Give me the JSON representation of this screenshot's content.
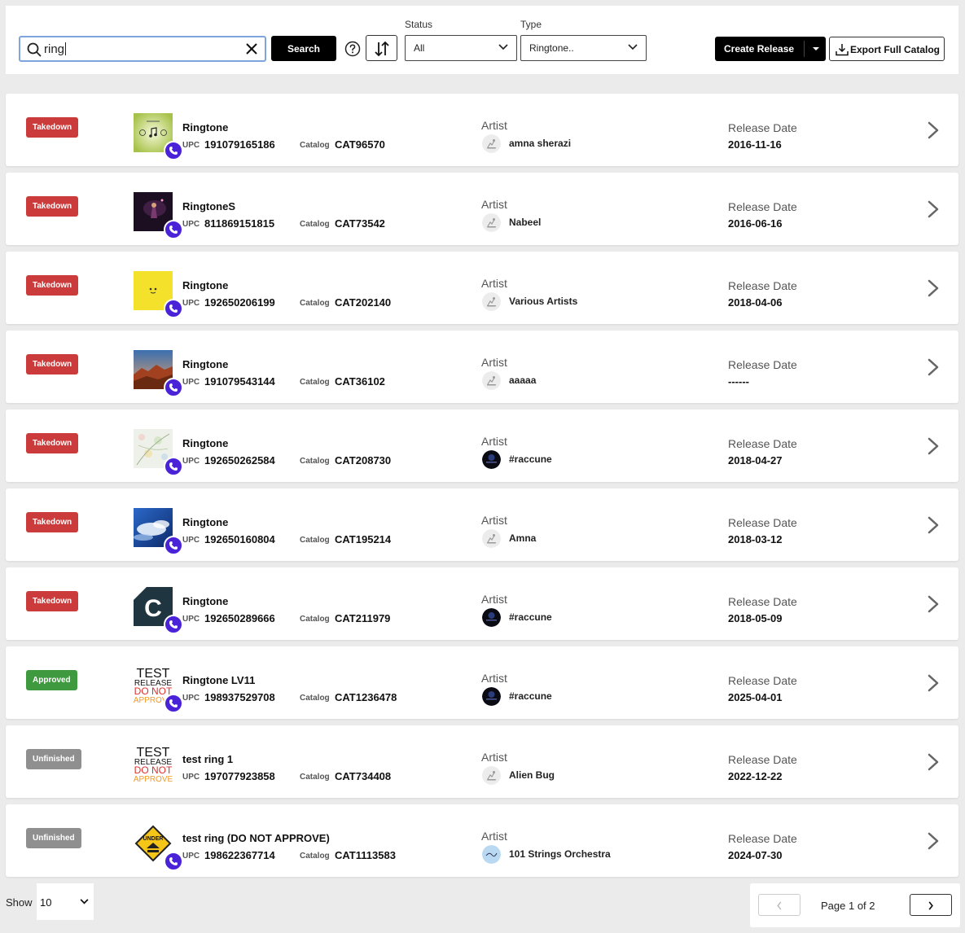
{
  "search": {
    "value": "ring",
    "button_label": "Search"
  },
  "filters": {
    "status_label": "Status",
    "status_value": "All",
    "type_label": "Type",
    "type_value": "Ringtone.."
  },
  "actions": {
    "create_label": "Create Release",
    "export_label": "Export Full Catalog"
  },
  "list_labels": {
    "upc": "UPC",
    "catalog": "Catalog",
    "artist": "Artist",
    "release_date": "Release Date"
  },
  "status_colors": {
    "Takedown": "#cc3b3b",
    "Approved": "#3f9a3f",
    "Unfinished": "#8f8f8f"
  },
  "releases": [
    {
      "status": "Takedown",
      "title": "Ringtone",
      "upc": "191079165186",
      "catalog": "CAT96570",
      "artist": "amna sherazi",
      "release_date": "2016-11-16",
      "art": "lime-music-art",
      "avatar": "placeholder"
    },
    {
      "status": "Takedown",
      "title": "RingtoneS",
      "upc": "811869151815",
      "catalog": "CAT73542",
      "artist": "Nabeel",
      "release_date": "2016-06-16",
      "art": "dark-concert-art",
      "avatar": "placeholder"
    },
    {
      "status": "Takedown",
      "title": "Ringtone",
      "upc": "192650206199",
      "catalog": "CAT202140",
      "artist": "Various Artists",
      "release_date": "2018-04-06",
      "art": "yellow-art",
      "avatar": "placeholder"
    },
    {
      "status": "Takedown",
      "title": "Ringtone",
      "upc": "191079543144",
      "catalog": "CAT36102",
      "artist": "aaaaa",
      "release_date": "------",
      "art": "canyon-art",
      "avatar": "placeholder"
    },
    {
      "status": "Takedown",
      "title": "Ringtone",
      "upc": "192650262584",
      "catalog": "CAT208730",
      "artist": "#raccune",
      "release_date": "2018-04-27",
      "art": "floral-art",
      "avatar": "dark"
    },
    {
      "status": "Takedown",
      "title": "Ringtone",
      "upc": "192650160804",
      "catalog": "CAT195214",
      "artist": "Amna",
      "release_date": "2018-03-12",
      "art": "sky-art",
      "avatar": "placeholder"
    },
    {
      "status": "Takedown",
      "title": "Ringtone",
      "upc": "192650289666",
      "catalog": "CAT211979",
      "artist": "#raccune",
      "release_date": "2018-05-09",
      "art": "c-logo-art",
      "avatar": "dark"
    },
    {
      "status": "Approved",
      "title": "Ringtone LV11",
      "upc": "198937529708",
      "catalog": "CAT1236478",
      "artist": "#raccune",
      "release_date": "2025-04-01",
      "art": "test-release-art",
      "avatar": "dark"
    },
    {
      "status": "Unfinished",
      "title": "test ring 1",
      "upc": "197077923858",
      "catalog": "CAT734408",
      "artist": "Alien Bug",
      "release_date": "2022-12-22",
      "art": "test-release-art",
      "avatar": "placeholder",
      "no_phone": true
    },
    {
      "status": "Unfinished",
      "title": "test ring (DO NOT APPROVE)",
      "upc": "198622367714",
      "catalog": "CAT1113583",
      "artist": "101 Strings Orchestra",
      "release_date": "2024-07-30",
      "art": "under-construction-art",
      "avatar": "light"
    }
  ],
  "test_art_text": {
    "line1": "TEST",
    "line2": "RELEASE",
    "line3": "DO NOT",
    "line4": "APPROVE"
  },
  "under_construction_text": "UNDER",
  "c_logo_text": "C",
  "footer": {
    "show_label": "Show",
    "page_size": "10",
    "page_text": "Page 1 of 2"
  }
}
